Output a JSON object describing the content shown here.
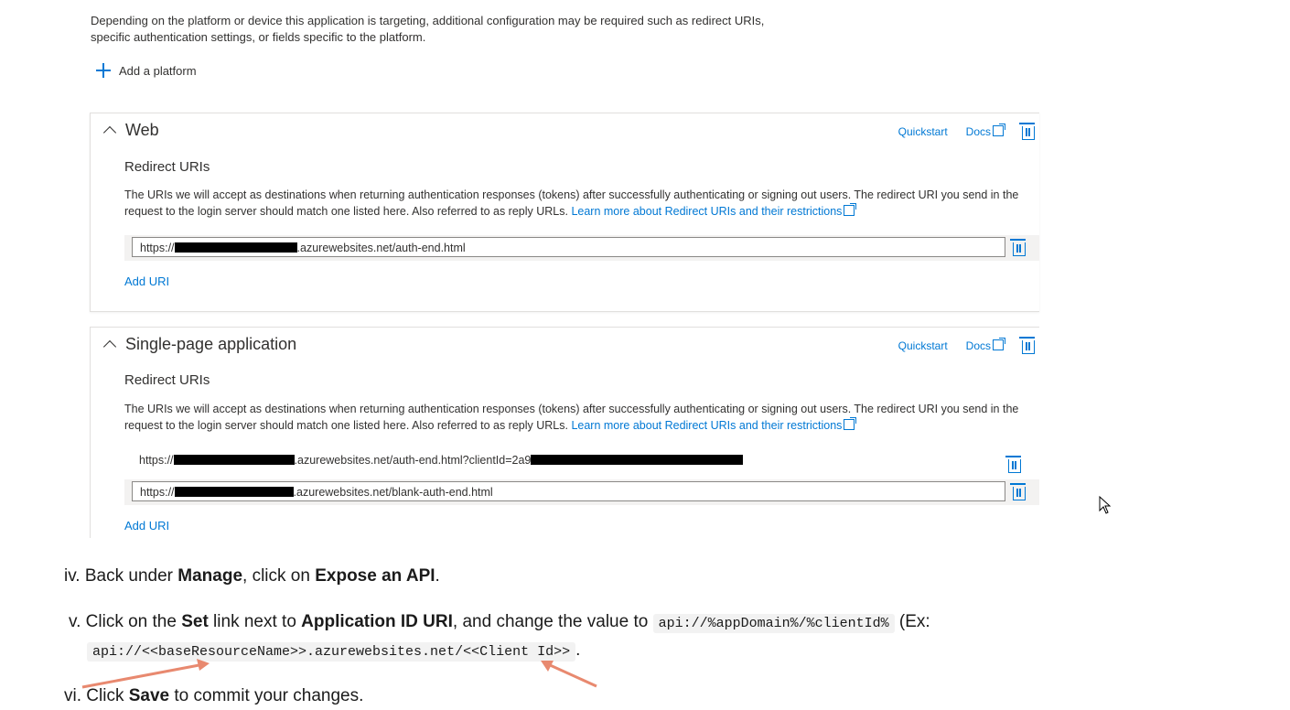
{
  "intro": {
    "text": "Depending on the platform or device this application is targeting, additional configuration may be required such as redirect URIs, specific authentication settings, or fields specific to the platform.",
    "add_platform_label": "Add a platform"
  },
  "web_panel": {
    "title": "Web",
    "quickstart": "Quickstart",
    "docs": "Docs",
    "redirect_label": "Redirect URIs",
    "description": "The URIs we will accept as destinations when returning authentication responses (tokens) after successfully authenticating or signing out users. The redirect URI you send in the request to the login server should match one listed here. Also referred to as reply URLs. ",
    "learn_more": "Learn more about Redirect URIs and their restrictions",
    "uris": [
      {
        "prefix": "https://",
        "suffix": ".azurewebsites.net/auth-end.html"
      }
    ],
    "add_uri": "Add URI"
  },
  "spa_panel": {
    "title": "Single-page application",
    "quickstart": "Quickstart",
    "docs": "Docs",
    "redirect_label": "Redirect URIs",
    "description": "The URIs we will accept as destinations when returning authentication responses (tokens) after successfully authenticating or signing out users. The redirect URI you send in the request to the login server should match one listed here. Also referred to as reply URLs. ",
    "learn_more": "Learn more about Redirect URIs and their restrictions",
    "uris": [
      {
        "prefix": "https://",
        "suffix": ".azurewebsites.net/auth-end.html?clientId=2a9"
      },
      {
        "prefix": "https://",
        "suffix": ".azurewebsites.net/blank-auth-end.html"
      }
    ],
    "add_uri": "Add URI"
  },
  "steps": {
    "iv": {
      "marker": "iv.",
      "t1": "Back under ",
      "b1": "Manage",
      "t2": ", click on ",
      "b2": "Expose an API",
      "t3": "."
    },
    "v": {
      "marker": "v.",
      "t1": "Click on the ",
      "b1": "Set",
      "t2": " link next to ",
      "b2": "Application ID URI",
      "t3": ", and change the value to ",
      "code1": "api://%appDomain%/%clientId%",
      "t4": " (Ex:",
      "code2": "api://<<baseResourceName>>.azurewebsites.net/<<Client Id>>",
      "t5": "."
    },
    "vi": {
      "marker": "vi.",
      "t1": "Click ",
      "b1": "Save",
      "t2": " to commit your changes."
    }
  },
  "colors": {
    "link": "#0078d4",
    "arrow": "#e8896f"
  }
}
